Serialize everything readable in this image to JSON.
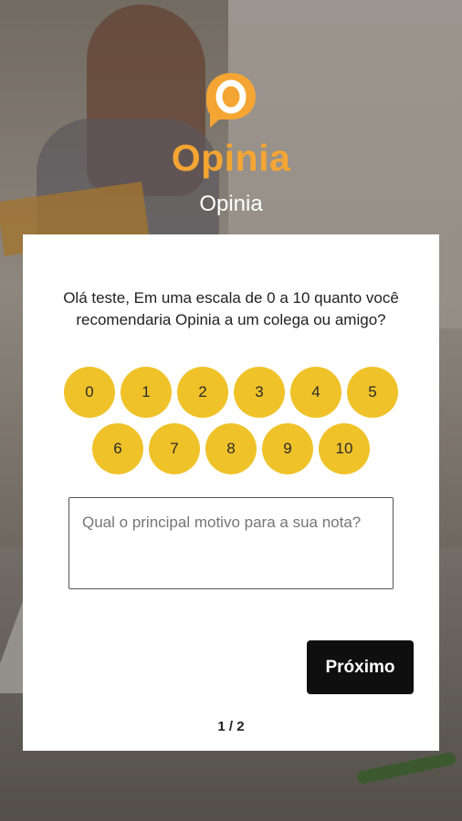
{
  "brand": {
    "logo_icon": "speech-bubble-o-icon",
    "wordmark": "Opinia",
    "subtitle": "Opinia",
    "accent_color": "#f4a533"
  },
  "survey": {
    "question": "Olá teste, Em uma escala de 0 a 10 quanto você recomendaria Opinia a um colega ou amigo?",
    "scores_row1": [
      "0",
      "1",
      "2",
      "3",
      "4",
      "5"
    ],
    "scores_row2": [
      "6",
      "7",
      "8",
      "9",
      "10"
    ],
    "score_color": "#f0c229",
    "reason_placeholder": "Qual o principal motivo para a sua nota?",
    "reason_value": "",
    "next_label": "Próximo",
    "pager": "1 / 2"
  }
}
